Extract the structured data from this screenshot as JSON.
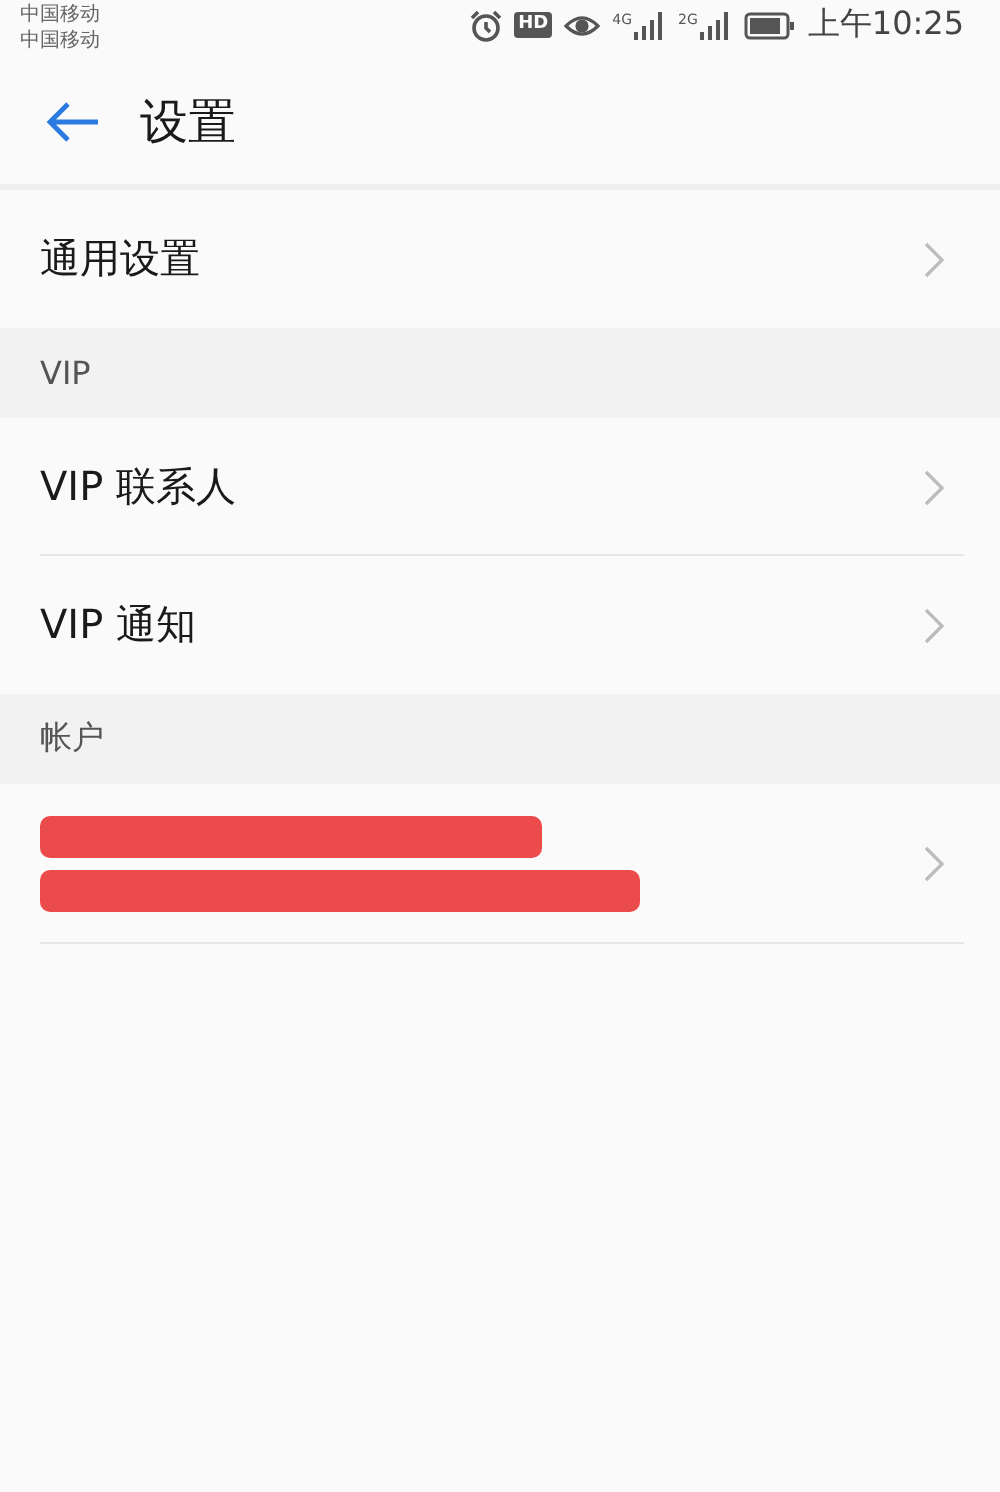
{
  "status_bar": {
    "carriers": [
      "中国移动",
      "中国移动"
    ],
    "hd": "HD",
    "networks": [
      "4G",
      "2G"
    ],
    "time": "上午10:25"
  },
  "header": {
    "title": "设置"
  },
  "sections": [
    {
      "items": [
        {
          "kind": "text",
          "label": "通用设置"
        }
      ]
    },
    {
      "title": "VIP",
      "items": [
        {
          "kind": "text",
          "label": "VIP 联系人"
        },
        {
          "kind": "text",
          "label": "VIP 通知"
        }
      ]
    },
    {
      "title": "帐户",
      "items": [
        {
          "kind": "redacted"
        }
      ]
    }
  ]
}
